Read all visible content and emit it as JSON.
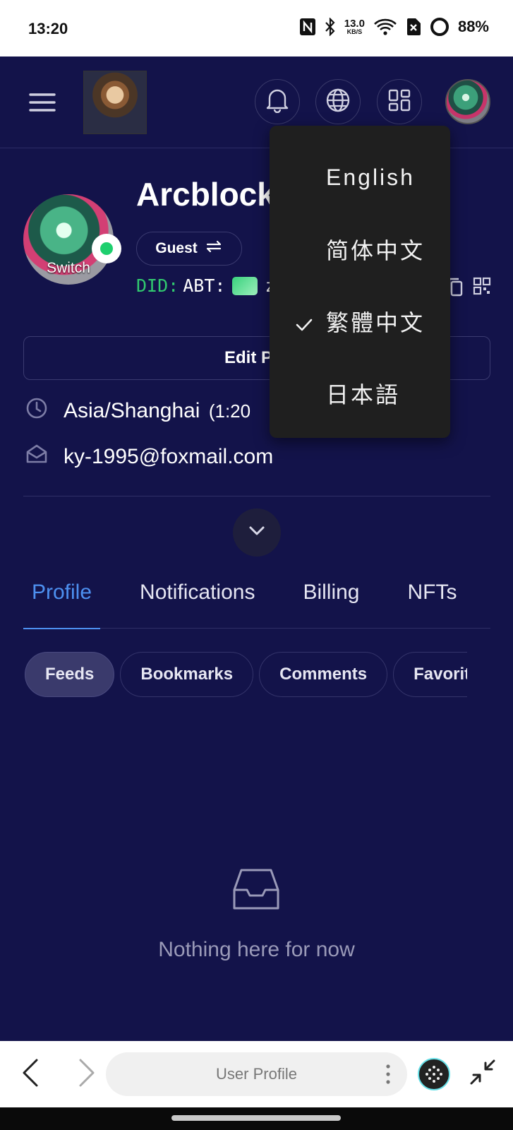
{
  "status_bar": {
    "time": "13:20",
    "speed_value": "13.0",
    "speed_unit": "KB/S",
    "battery": "88%"
  },
  "header": {
    "menu_icon": "hamburger-icon",
    "notification_icon": "bell-icon",
    "language_icon": "globe-icon",
    "apps_icon": "grid-icon"
  },
  "profile": {
    "name": "Arcblock",
    "switch_label": "Switch",
    "role": "Guest",
    "did_prefix": "DID:",
    "did_chain": "ABT:",
    "did_tail": "z",
    "edit_button": "Edit Pro",
    "timezone": "Asia/Shanghai",
    "timezone_extra": "(1:20",
    "email": "ky-1995@foxmail.com"
  },
  "tabs": [
    {
      "label": "Profile",
      "active": true
    },
    {
      "label": "Notifications",
      "active": false
    },
    {
      "label": "Billing",
      "active": false
    },
    {
      "label": "NFTs",
      "active": false
    }
  ],
  "chips": [
    {
      "label": "Feeds",
      "active": true
    },
    {
      "label": "Bookmarks",
      "active": false
    },
    {
      "label": "Comments",
      "active": false
    },
    {
      "label": "Favorite",
      "active": false
    }
  ],
  "empty_state": {
    "message": "Nothing here for now"
  },
  "language_menu": {
    "items": [
      {
        "label": "English",
        "selected": false
      },
      {
        "label": "简体中文",
        "selected": false
      },
      {
        "label": "繁體中文",
        "selected": true
      },
      {
        "label": "日本語",
        "selected": false
      }
    ]
  },
  "browser": {
    "title": "User Profile"
  },
  "colors": {
    "background": "#13134a",
    "accent": "#4d90f0",
    "did_green": "#31c96f",
    "menu_bg": "#1f1f1f"
  }
}
